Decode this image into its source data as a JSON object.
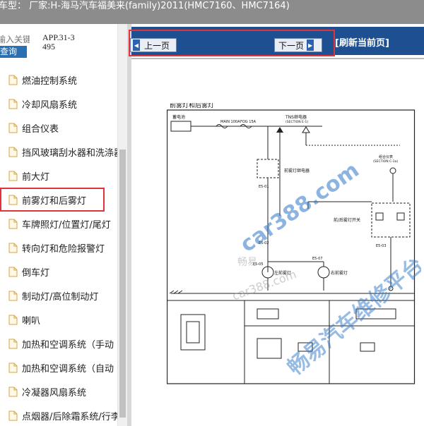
{
  "topbar": {
    "text": "车型：  厂家:H-海马汽车福美来(family)2011(HMC7160、HMC7164)"
  },
  "search": {
    "placeholder": "输入关键",
    "button_label": "查询"
  },
  "app_id": "APP.31-3495",
  "tree": {
    "items": [
      {
        "label": "燃油控制系统"
      },
      {
        "label": "冷却风扇系统"
      },
      {
        "label": "组合仪表"
      },
      {
        "label": "挡风玻璃刮水器和洗涤器"
      },
      {
        "label": "前大灯"
      },
      {
        "label": "前雾灯和后雾灯",
        "selected": true
      },
      {
        "label": "车牌照灯/位置灯/尾灯"
      },
      {
        "label": "转向灯和危险报警灯"
      },
      {
        "label": "倒车灯"
      },
      {
        "label": "制动灯/高位制动灯"
      },
      {
        "label": "喇叭"
      },
      {
        "label": "加热和空调系统（手动"
      },
      {
        "label": "加热和空调系统（自动"
      },
      {
        "label": "冷凝器风扇系统"
      },
      {
        "label": "点烟器/后除霜系统/行李"
      }
    ]
  },
  "toolbar": {
    "prev_label": "上一页",
    "next_label": "下一页",
    "refresh_label": "[刷新当前页]"
  },
  "diagram": {
    "title": "前雾灯和后雾灯",
    "labels": {
      "battery": "蓄电池",
      "main": "MAIN 100A",
      "fog": "FOG 15A",
      "tns_relay": "TNS继电器",
      "tns_section": "(SECTION E-1)",
      "fog_relay": "前雾灯继电器",
      "combo_switch": "组合仪表",
      "combo_section": "(SECTION C-1a)",
      "fog_switch": "前/后雾灯开关",
      "left_front_fog": "左前雾灯",
      "right_front_fog": "右前雾灯",
      "connector_e501": "E5-01",
      "connector_e502": "E5-02",
      "connector_e503": "E5-03",
      "connector_e505": "E5-05",
      "connector_e507": "E5-07"
    },
    "watermarks": [
      "car388.com",
      "畅易汽车维修平台",
      "car388.com",
      "畅易"
    ]
  }
}
